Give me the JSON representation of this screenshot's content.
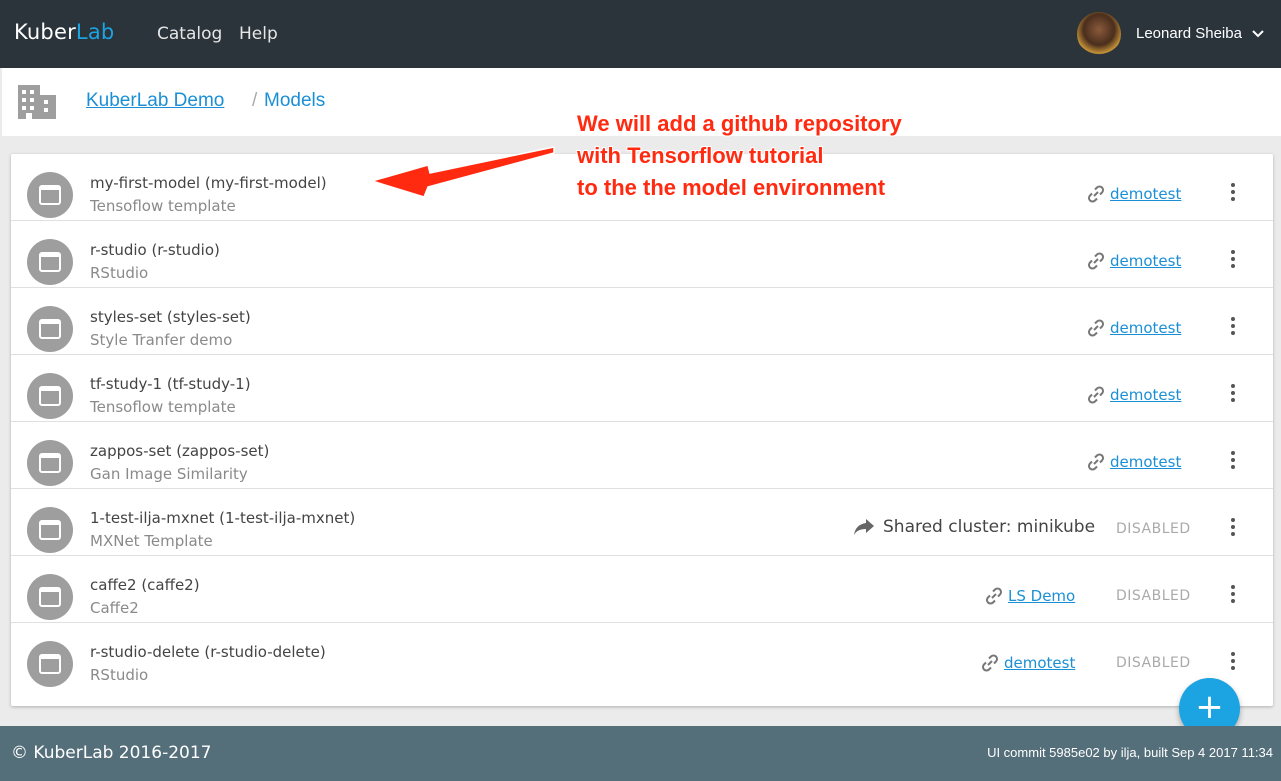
{
  "topbar": {
    "brand_main": "Kuber",
    "brand_accent": "Lab",
    "nav": [
      "Catalog",
      "Help"
    ],
    "username": "Leonard Sheiba"
  },
  "breadcrumb": {
    "org": "KuberLab Demo",
    "separator": "/",
    "current": "Models"
  },
  "annotation": {
    "lines": [
      "We will add a github repository",
      "with Tensorflow tutorial",
      "to the the model environment"
    ],
    "color": "#ff2a10"
  },
  "models": [
    {
      "title": "my-first-model (my-first-model)",
      "subtitle": "Tensoflow template",
      "link": "demotest",
      "status": ""
    },
    {
      "title": "r-studio (r-studio)",
      "subtitle": "RStudio",
      "link": "demotest",
      "status": ""
    },
    {
      "title": "styles-set (styles-set)",
      "subtitle": "Style Tranfer demo",
      "link": "demotest",
      "status": ""
    },
    {
      "title": "tf-study-1 (tf-study-1)",
      "subtitle": "Tensoflow template",
      "link": "demotest",
      "status": ""
    },
    {
      "title": "zappos-set (zappos-set)",
      "subtitle": "Gan Image Similarity",
      "link": "demotest",
      "status": ""
    },
    {
      "title": "1-test-ilja-mxnet (1-test-ilja-mxnet)",
      "subtitle": "MXNet Template",
      "shared": "Shared cluster: minikube",
      "status": "DISABLED"
    },
    {
      "title": "caffe2 (caffe2)",
      "subtitle": "Caffe2",
      "link": "LS Demo",
      "status": "DISABLED"
    },
    {
      "title": "r-studio-delete (r-studio-delete)",
      "subtitle": "RStudio",
      "link": "demotest",
      "status": "DISABLED"
    }
  ],
  "fab": {
    "label": "+"
  },
  "footer": {
    "copyright": "© KuberLab 2016-2017",
    "commit": "UI commit 5985e02 by ilja, built Sep 4 2017 11:34"
  },
  "colors": {
    "topbar": "#2b333b",
    "accent": "#1ba3e2",
    "link": "#1b8fd6",
    "footer": "#546e7a"
  }
}
